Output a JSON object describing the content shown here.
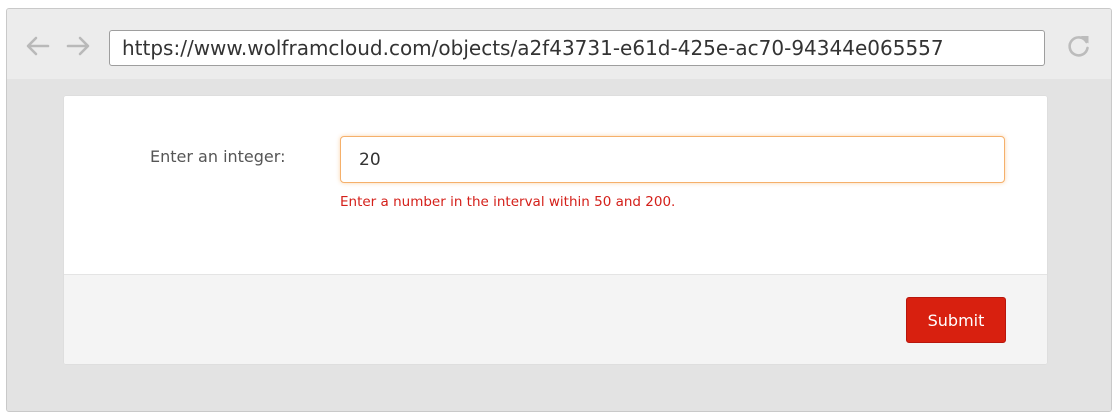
{
  "browser": {
    "url": "https://www.wolframcloud.com/objects/a2f43731-e61d-425e-ac70-94344e065557",
    "icons": {
      "back": "arrow-left-icon",
      "forward": "arrow-right-icon",
      "reload": "reload-icon"
    }
  },
  "form": {
    "field_label": "Enter an integer:",
    "input_value": "20",
    "error_message": "Enter a number in the interval within 50 and 200.",
    "submit_label": "Submit"
  },
  "colors": {
    "error_text": "#d4201a",
    "submit_background": "#d8200f",
    "input_focus_border": "#f5b06b"
  }
}
